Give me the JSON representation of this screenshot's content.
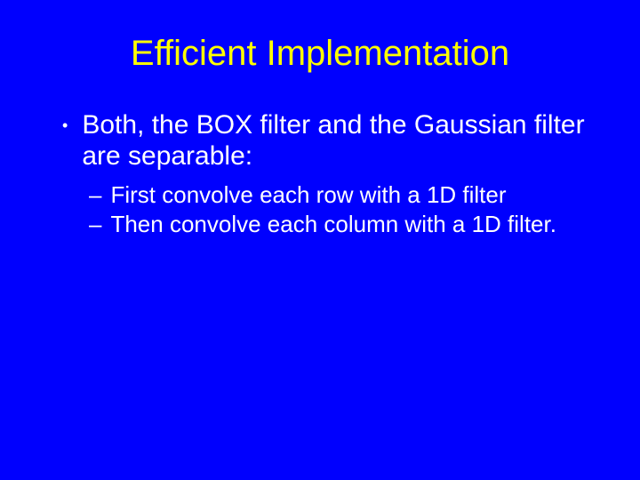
{
  "title": "Efficient Implementation",
  "bullet1": "Both, the BOX filter and the Gaussian filter are separable:",
  "sub": [
    "First convolve each row with a 1D filter",
    "Then convolve each column with a 1D filter."
  ],
  "symbols": {
    "dot": "•",
    "dash": "–"
  }
}
